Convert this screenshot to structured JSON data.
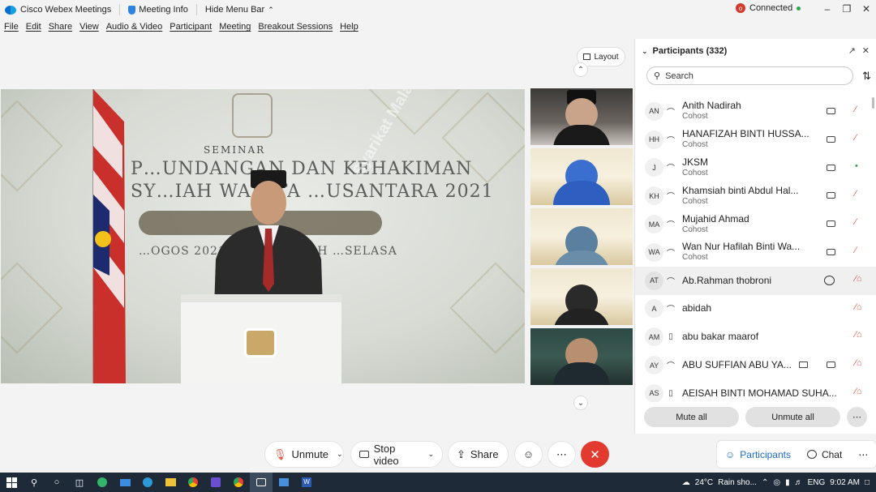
{
  "titlebar": {
    "app_name": "Cisco Webex Meetings",
    "meeting_info": "Meeting Info",
    "hide_menu_bar": "Hide Menu Bar",
    "status": "Connected",
    "status_color": "#2fa84f"
  },
  "menu": [
    "File",
    "Edit",
    "Share",
    "View",
    "Audio & Video",
    "Participant",
    "Meeting",
    "Breakout Sessions",
    "Help"
  ],
  "layout_button": "Layout",
  "stage": {
    "title_small": "SEMINAR",
    "line1": "P…UNDANGAN DAN KEHAKIMAN",
    "line2": "SY…IAH WANITA …USANTARA 2021",
    "line3": "…OGOS 2021 | 15 M… …43H …SELASA",
    "watermark": "Syarikat Malaysia Jabatan Kehakiman"
  },
  "participants": {
    "title": "Participants (332)",
    "search_placeholder": "Search",
    "rows": [
      {
        "initials": "AN",
        "name": "Anith Nadirah",
        "role": "Cohost",
        "device": "headset",
        "video": true,
        "mic": "muted"
      },
      {
        "initials": "HH",
        "name": "HANAFIZAH BINTI HUSSA...",
        "role": "Cohost",
        "device": "headset",
        "video": true,
        "mic": "muted"
      },
      {
        "initials": "J",
        "name": "JKSM",
        "role": "Cohost",
        "device": "headset",
        "video": true,
        "mic": "on"
      },
      {
        "initials": "KH",
        "name": "Khamsiah binti Abdul Hal...",
        "role": "Cohost",
        "device": "headset",
        "video": true,
        "mic": "muted"
      },
      {
        "initials": "MA",
        "name": "Mujahid Ahmad",
        "role": "Cohost",
        "device": "headset",
        "video": true,
        "mic": "muted"
      },
      {
        "initials": "WA",
        "name": "Wan Nur Hafilah Binti Wa...",
        "role": "Cohost",
        "device": "headset",
        "video": true,
        "mic": "muted"
      },
      {
        "initials": "AT",
        "name": "Ab.Rahman thobroni",
        "role": "",
        "device": "headset",
        "video": false,
        "chat": true,
        "mic": "muted-locked",
        "highlight": true
      },
      {
        "initials": "A",
        "name": "abidah",
        "role": "",
        "device": "headset",
        "video": false,
        "mic": "muted-locked"
      },
      {
        "initials": "AM",
        "name": "abu bakar maarof",
        "role": "",
        "device": "phone",
        "video": false,
        "mic": "muted-locked"
      },
      {
        "initials": "AY",
        "name": "ABU SUFFIAN ABU YA...",
        "role": "",
        "device": "headset",
        "video": true,
        "caption": true,
        "mic": "muted-locked"
      },
      {
        "initials": "AS",
        "name": "AEISAH BINTI MOHAMAD SUHA...",
        "role": "",
        "device": "phone",
        "video": false,
        "mic": "muted-locked"
      }
    ],
    "mute_all": "Mute all",
    "unmute_all": "Unmute all"
  },
  "controls": {
    "unmute": "Unmute",
    "stop_video": "Stop video",
    "share": "Share",
    "participants": "Participants",
    "chat": "Chat",
    "end_color": "#e23a2f"
  },
  "taskbar": {
    "temperature": "24°C",
    "weather": "Rain sho...",
    "language": "ENG",
    "time": "9:02 AM"
  }
}
